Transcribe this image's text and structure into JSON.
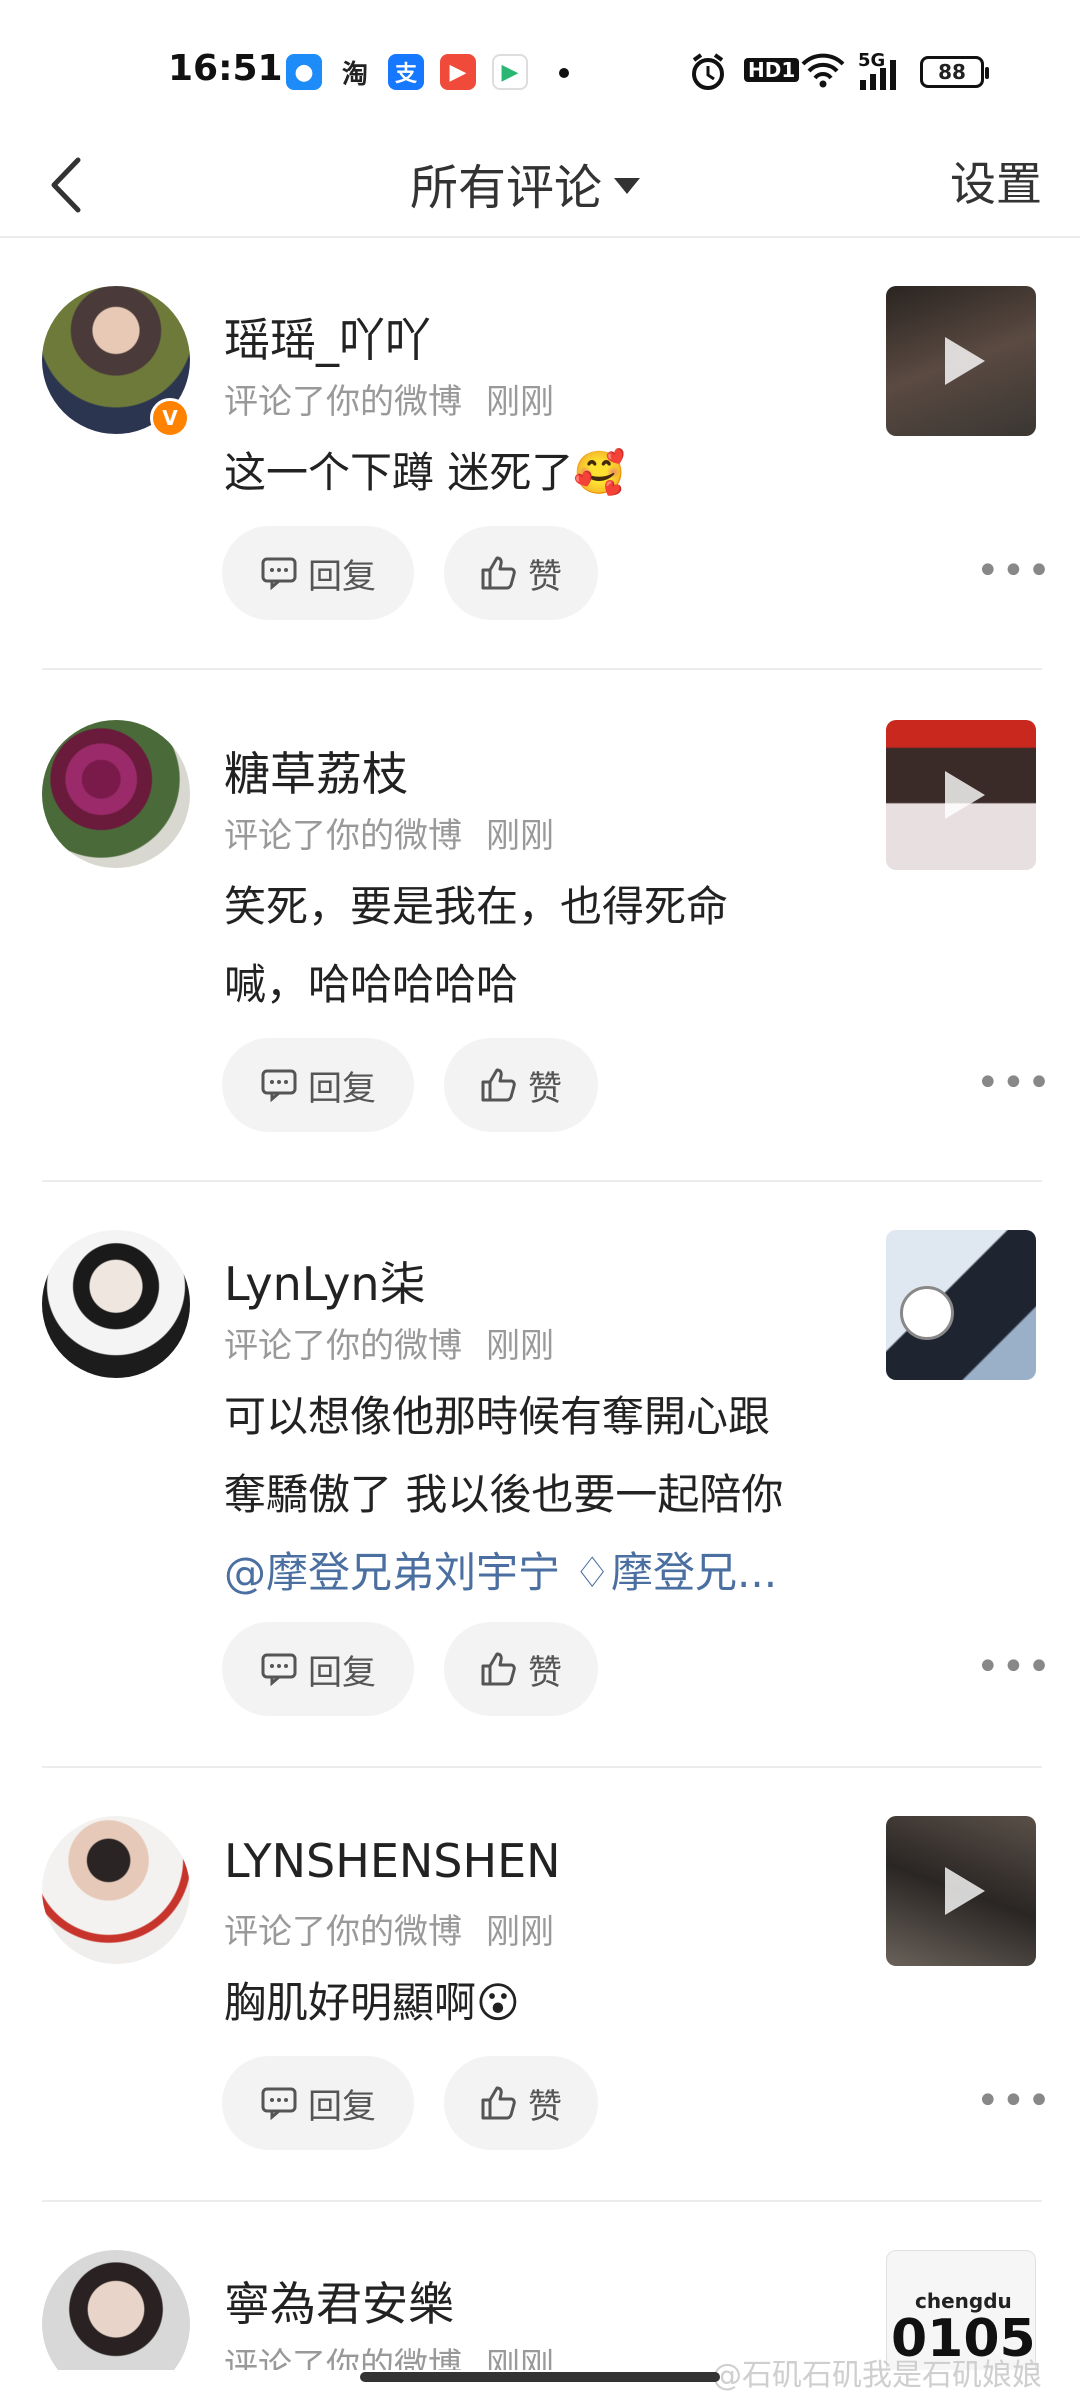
{
  "status_bar": {
    "time": "16:51",
    "apps": [
      "qq-icon",
      "taobao-icon",
      "alipay-icon",
      "youku-icon",
      "app-icon"
    ],
    "app_labels": {
      "taobao": "淘",
      "alipay": "支"
    },
    "network": "5G",
    "hd": "HD1",
    "battery": "88"
  },
  "header": {
    "title": "所有评论",
    "settings": "设置"
  },
  "comments": [
    {
      "username": "瑶瑶_吖吖",
      "action": "评论了你的微博",
      "time": "刚刚",
      "lines": [
        "这一个下蹲 迷死了🥰"
      ],
      "verified": true,
      "has_video": true
    },
    {
      "username": "糖草荔枝",
      "action": "评论了你的微博",
      "time": "刚刚",
      "lines": [
        "笑死，要是我在，也得死命",
        "喊，哈哈哈哈哈"
      ],
      "verified": false,
      "has_video": true
    },
    {
      "username": "LynLyn柒",
      "action": "评论了你的微博",
      "time": "刚刚",
      "lines": [
        "可以想像他那時候有奪開心跟",
        "奪驕傲了 我以後也要一起陪你"
      ],
      "mention_line": "@摩登兄弟刘宇宁 ♢摩登兄...",
      "verified": false,
      "has_video": false
    },
    {
      "username": "LYNSHENSHEN",
      "action": "评论了你的微博",
      "time": "刚刚",
      "lines": [
        "胸肌好明顯啊😮"
      ],
      "verified": false,
      "has_video": true
    },
    {
      "username": "寧為君安樂",
      "action": "评论了你的微博",
      "time": "刚刚",
      "lines": [],
      "verified": false,
      "has_video": false
    }
  ],
  "actions": {
    "reply": "回复",
    "like": "赞",
    "more": "•••"
  },
  "watermark": "@石矶石矶我是石矶娘娘",
  "thumb5_text": {
    "top": "chengdu",
    "big": "0105"
  }
}
